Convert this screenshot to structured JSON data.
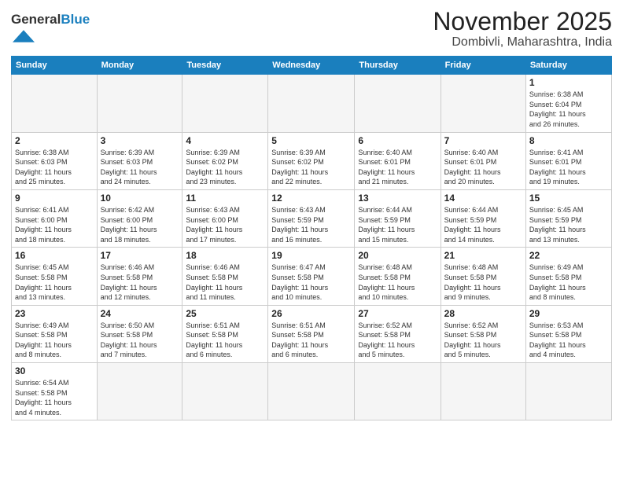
{
  "logo": {
    "text_general": "General",
    "text_blue": "Blue"
  },
  "title": "November 2025",
  "subtitle": "Dombivli, Maharashtra, India",
  "days_of_week": [
    "Sunday",
    "Monday",
    "Tuesday",
    "Wednesday",
    "Thursday",
    "Friday",
    "Saturday"
  ],
  "weeks": [
    [
      {
        "day": "",
        "info": "",
        "empty": true
      },
      {
        "day": "",
        "info": "",
        "empty": true
      },
      {
        "day": "",
        "info": "",
        "empty": true
      },
      {
        "day": "",
        "info": "",
        "empty": true
      },
      {
        "day": "",
        "info": "",
        "empty": true
      },
      {
        "day": "",
        "info": "",
        "empty": true
      },
      {
        "day": "1",
        "info": "Sunrise: 6:38 AM\nSunset: 6:04 PM\nDaylight: 11 hours\nand 26 minutes.",
        "empty": false
      }
    ],
    [
      {
        "day": "2",
        "info": "Sunrise: 6:38 AM\nSunset: 6:03 PM\nDaylight: 11 hours\nand 25 minutes.",
        "empty": false
      },
      {
        "day": "3",
        "info": "Sunrise: 6:39 AM\nSunset: 6:03 PM\nDaylight: 11 hours\nand 24 minutes.",
        "empty": false
      },
      {
        "day": "4",
        "info": "Sunrise: 6:39 AM\nSunset: 6:02 PM\nDaylight: 11 hours\nand 23 minutes.",
        "empty": false
      },
      {
        "day": "5",
        "info": "Sunrise: 6:39 AM\nSunset: 6:02 PM\nDaylight: 11 hours\nand 22 minutes.",
        "empty": false
      },
      {
        "day": "6",
        "info": "Sunrise: 6:40 AM\nSunset: 6:01 PM\nDaylight: 11 hours\nand 21 minutes.",
        "empty": false
      },
      {
        "day": "7",
        "info": "Sunrise: 6:40 AM\nSunset: 6:01 PM\nDaylight: 11 hours\nand 20 minutes.",
        "empty": false
      },
      {
        "day": "8",
        "info": "Sunrise: 6:41 AM\nSunset: 6:01 PM\nDaylight: 11 hours\nand 19 minutes.",
        "empty": false
      }
    ],
    [
      {
        "day": "9",
        "info": "Sunrise: 6:41 AM\nSunset: 6:00 PM\nDaylight: 11 hours\nand 18 minutes.",
        "empty": false
      },
      {
        "day": "10",
        "info": "Sunrise: 6:42 AM\nSunset: 6:00 PM\nDaylight: 11 hours\nand 18 minutes.",
        "empty": false
      },
      {
        "day": "11",
        "info": "Sunrise: 6:43 AM\nSunset: 6:00 PM\nDaylight: 11 hours\nand 17 minutes.",
        "empty": false
      },
      {
        "day": "12",
        "info": "Sunrise: 6:43 AM\nSunset: 5:59 PM\nDaylight: 11 hours\nand 16 minutes.",
        "empty": false
      },
      {
        "day": "13",
        "info": "Sunrise: 6:44 AM\nSunset: 5:59 PM\nDaylight: 11 hours\nand 15 minutes.",
        "empty": false
      },
      {
        "day": "14",
        "info": "Sunrise: 6:44 AM\nSunset: 5:59 PM\nDaylight: 11 hours\nand 14 minutes.",
        "empty": false
      },
      {
        "day": "15",
        "info": "Sunrise: 6:45 AM\nSunset: 5:59 PM\nDaylight: 11 hours\nand 13 minutes.",
        "empty": false
      }
    ],
    [
      {
        "day": "16",
        "info": "Sunrise: 6:45 AM\nSunset: 5:58 PM\nDaylight: 11 hours\nand 13 minutes.",
        "empty": false
      },
      {
        "day": "17",
        "info": "Sunrise: 6:46 AM\nSunset: 5:58 PM\nDaylight: 11 hours\nand 12 minutes.",
        "empty": false
      },
      {
        "day": "18",
        "info": "Sunrise: 6:46 AM\nSunset: 5:58 PM\nDaylight: 11 hours\nand 11 minutes.",
        "empty": false
      },
      {
        "day": "19",
        "info": "Sunrise: 6:47 AM\nSunset: 5:58 PM\nDaylight: 11 hours\nand 10 minutes.",
        "empty": false
      },
      {
        "day": "20",
        "info": "Sunrise: 6:48 AM\nSunset: 5:58 PM\nDaylight: 11 hours\nand 10 minutes.",
        "empty": false
      },
      {
        "day": "21",
        "info": "Sunrise: 6:48 AM\nSunset: 5:58 PM\nDaylight: 11 hours\nand 9 minutes.",
        "empty": false
      },
      {
        "day": "22",
        "info": "Sunrise: 6:49 AM\nSunset: 5:58 PM\nDaylight: 11 hours\nand 8 minutes.",
        "empty": false
      }
    ],
    [
      {
        "day": "23",
        "info": "Sunrise: 6:49 AM\nSunset: 5:58 PM\nDaylight: 11 hours\nand 8 minutes.",
        "empty": false
      },
      {
        "day": "24",
        "info": "Sunrise: 6:50 AM\nSunset: 5:58 PM\nDaylight: 11 hours\nand 7 minutes.",
        "empty": false
      },
      {
        "day": "25",
        "info": "Sunrise: 6:51 AM\nSunset: 5:58 PM\nDaylight: 11 hours\nand 6 minutes.",
        "empty": false
      },
      {
        "day": "26",
        "info": "Sunrise: 6:51 AM\nSunset: 5:58 PM\nDaylight: 11 hours\nand 6 minutes.",
        "empty": false
      },
      {
        "day": "27",
        "info": "Sunrise: 6:52 AM\nSunset: 5:58 PM\nDaylight: 11 hours\nand 5 minutes.",
        "empty": false
      },
      {
        "day": "28",
        "info": "Sunrise: 6:52 AM\nSunset: 5:58 PM\nDaylight: 11 hours\nand 5 minutes.",
        "empty": false
      },
      {
        "day": "29",
        "info": "Sunrise: 6:53 AM\nSunset: 5:58 PM\nDaylight: 11 hours\nand 4 minutes.",
        "empty": false
      }
    ],
    [
      {
        "day": "30",
        "info": "Sunrise: 6:54 AM\nSunset: 5:58 PM\nDaylight: 11 hours\nand 4 minutes.",
        "empty": false
      },
      {
        "day": "",
        "info": "",
        "empty": true
      },
      {
        "day": "",
        "info": "",
        "empty": true
      },
      {
        "day": "",
        "info": "",
        "empty": true
      },
      {
        "day": "",
        "info": "",
        "empty": true
      },
      {
        "day": "",
        "info": "",
        "empty": true
      },
      {
        "day": "",
        "info": "",
        "empty": true
      }
    ]
  ]
}
